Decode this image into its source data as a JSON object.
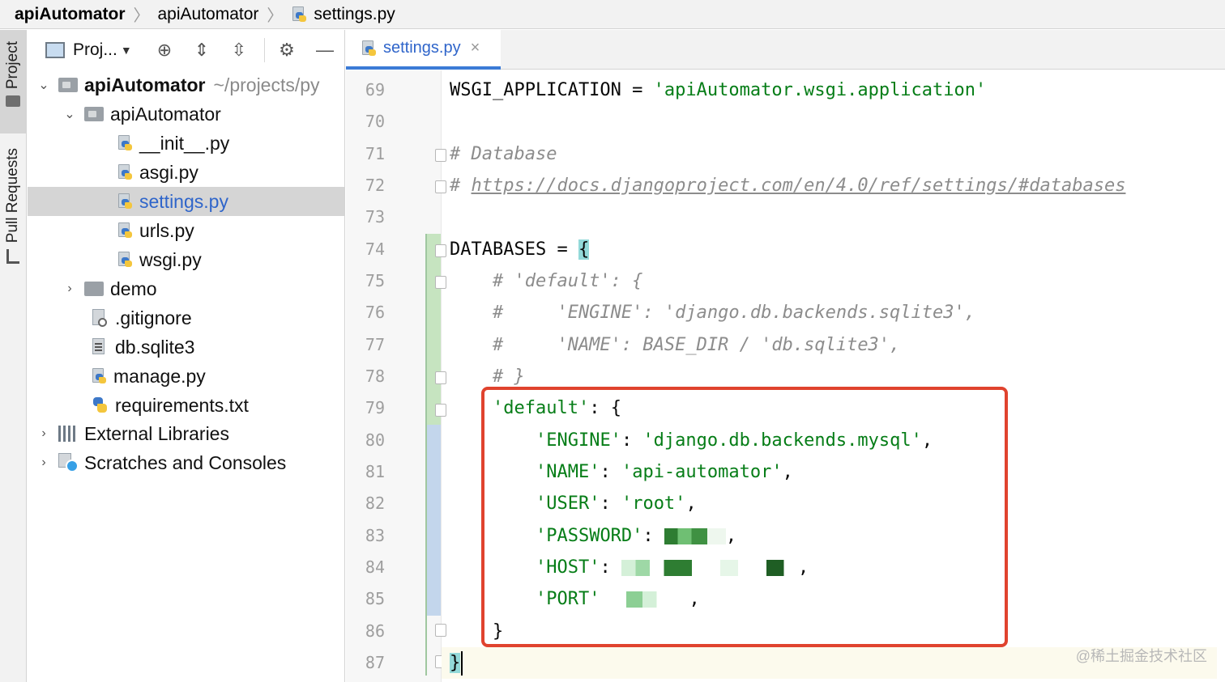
{
  "breadcrumb": {
    "project": "apiAutomator",
    "module": "apiAutomator",
    "file": "settings.py"
  },
  "tool_strip": {
    "project_tab": "Project",
    "pull_requests_tab": "Pull Requests"
  },
  "project_panel": {
    "view_label": "Proj...",
    "toolbar_icons": [
      "locate-icon",
      "expand-all-icon",
      "collapse-all-icon",
      "gear-icon",
      "minimize-icon"
    ],
    "tree": [
      {
        "label": "apiAutomator",
        "path": "~/projects/py"
      },
      {
        "label": "apiAutomator"
      },
      {
        "label": "__init__.py"
      },
      {
        "label": "asgi.py"
      },
      {
        "label": "settings.py"
      },
      {
        "label": "urls.py"
      },
      {
        "label": "wsgi.py"
      },
      {
        "label": "demo"
      },
      {
        "label": ".gitignore"
      },
      {
        "label": "db.sqlite3"
      },
      {
        "label": "manage.py"
      },
      {
        "label": "requirements.txt"
      },
      {
        "label": "External Libraries"
      },
      {
        "label": "Scratches and Consoles"
      }
    ]
  },
  "editor": {
    "tab_label": "settings.py",
    "tab_close": "×",
    "lines": [
      {
        "num": "69",
        "a": "WSGI_APPLICATION = ",
        "b": "'apiAutomator.wsgi.application'"
      },
      {
        "num": "70"
      },
      {
        "num": "71",
        "comment": "# Database"
      },
      {
        "num": "72",
        "hash": "# ",
        "link": "https://docs.djangoproject.com/en/4.0/ref/settings/#databases"
      },
      {
        "num": "73"
      },
      {
        "num": "74",
        "a": "DATABASES = ",
        "brace": "{"
      },
      {
        "num": "75",
        "comment": "    # 'default': {"
      },
      {
        "num": "76",
        "comment": "    #     'ENGINE': 'django.db.backends.sqlite3',"
      },
      {
        "num": "77",
        "comment": "    #     'NAME': BASE_DIR / 'db.sqlite3',"
      },
      {
        "num": "78",
        "comment": "    # }"
      },
      {
        "num": "79",
        "indent": "    ",
        "key": "'default'",
        "rest": ": {"
      },
      {
        "num": "80",
        "indent": "        ",
        "key": "'ENGINE'",
        "sep": ": ",
        "val": "'django.db.backends.mysql'",
        "rest": ","
      },
      {
        "num": "81",
        "indent": "        ",
        "key": "'NAME'",
        "sep": ": ",
        "val": "'api-automator'",
        "rest": ","
      },
      {
        "num": "82",
        "indent": "        ",
        "key": "'USER'",
        "sep": ": ",
        "val": "'root'",
        "rest": ","
      },
      {
        "num": "83",
        "indent": "        ",
        "key": "'PASSWORD'",
        "sep": ": ",
        "rest": ","
      },
      {
        "num": "84",
        "indent": "        ",
        "key": "'HOST'",
        "sep": ": ",
        "rest": ","
      },
      {
        "num": "85",
        "indent": "        ",
        "key": "'PORT'",
        "rest": ","
      },
      {
        "num": "86",
        "indent": "    ",
        "rest": "}"
      },
      {
        "num": "87",
        "brace": "}"
      }
    ]
  },
  "watermark": "@稀土掘金技术社区",
  "colors": {
    "string": "#067d17",
    "comment": "#8c8c8c",
    "selection_text": "#2f65ca",
    "highlight_box": "#e0432e",
    "brace_match": "#93d9d9"
  }
}
